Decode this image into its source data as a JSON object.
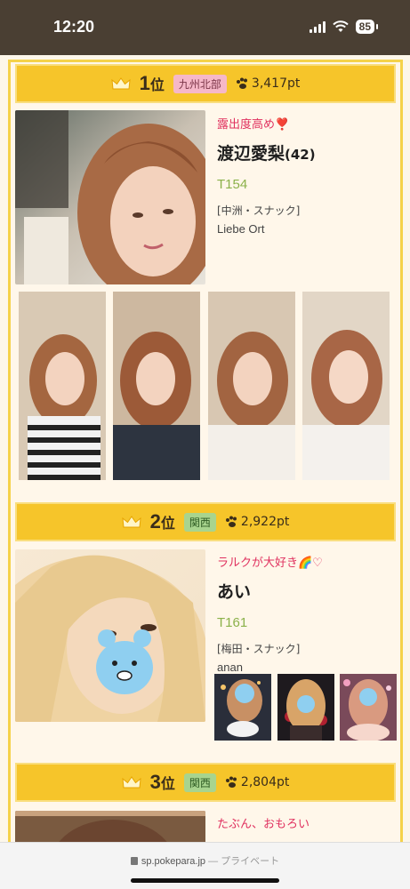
{
  "status_bar": {
    "time": "12:20",
    "battery": "85"
  },
  "rankings": [
    {
      "rank": "1",
      "rank_suffix": "位",
      "area": "九州北部",
      "points": "3,417pt",
      "tagline": "露出度高め❣️",
      "name": "渡辺愛梨",
      "age": "(42)",
      "height": "T154",
      "shop_area": "[中洲・スナック]",
      "shop": "Liebe Ort"
    },
    {
      "rank": "2",
      "rank_suffix": "位",
      "area": "関西",
      "points": "2,922pt",
      "tagline": "ラルクが大好き🌈♡",
      "name": "あい",
      "age": "",
      "height": "T161",
      "shop_area": "[梅田・スナック]",
      "shop": "anan"
    },
    {
      "rank": "3",
      "rank_suffix": "位",
      "area": "関西",
      "points": "2,804pt",
      "tagline": "たぶん、おもろい",
      "name": "",
      "age": "",
      "height": "",
      "shop_area": "",
      "shop": ""
    }
  ],
  "url_bar": {
    "domain": "sp.pokepara.jp",
    "separator": "—",
    "mode": "プライベート"
  },
  "colors": {
    "header_gold": "#f6c52a",
    "page_bg": "#fff7ea",
    "tagline_pink": "#e0315f",
    "height_green": "#8bb14a",
    "status_bar": "#4a3f33"
  }
}
